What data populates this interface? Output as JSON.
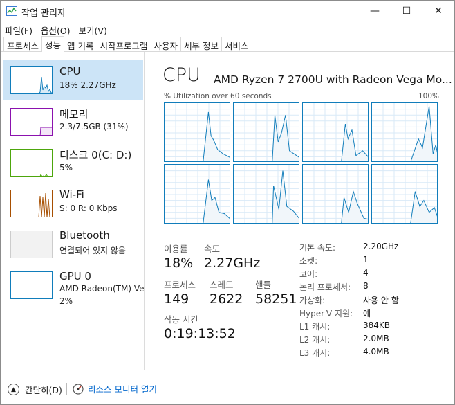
{
  "window": {
    "title": "작업 관리자",
    "controls": {
      "minimize": "—",
      "maximize": "☐",
      "close": "✕"
    }
  },
  "menu": [
    {
      "label": "파일(F)"
    },
    {
      "label": "옵션(O)"
    },
    {
      "label": "보기(V)"
    }
  ],
  "tabs": [
    {
      "label": "프로세스"
    },
    {
      "label": "성능",
      "active": true
    },
    {
      "label": "앱 기록"
    },
    {
      "label": "시작프로그램"
    },
    {
      "label": "사용자"
    },
    {
      "label": "세부 정보"
    },
    {
      "label": "서비스"
    }
  ],
  "sidebar": {
    "items": [
      {
        "name": "CPU",
        "sub": "18% 2.27GHz",
        "color": "#117dbb",
        "selected": true
      },
      {
        "name": "메모리",
        "sub": "2.3/7.5GB (31%)",
        "color": "#8b12ae"
      },
      {
        "name": "디스크 0(C: D:)",
        "sub": "5%",
        "color": "#4da60c"
      },
      {
        "name": "Wi-Fi",
        "sub": "S: 0 R: 0 Kbps",
        "color": "#a74f01"
      },
      {
        "name": "Bluetooth",
        "sub": "연결되어 있지 않음",
        "color": "#bbbbbb"
      },
      {
        "name": "GPU 0",
        "sub": "AMD Radeon(TM) Veg",
        "sub2": "2%",
        "color": "#117dbb"
      }
    ]
  },
  "main": {
    "title": "CPU",
    "model": "AMD Ryzen 7 2700U with Radeon Vega Mo...",
    "util_label": "% Utilization over 60 seconds",
    "util_max": "100%",
    "stats": {
      "utilization_label": "이용률",
      "utilization_value": "18%",
      "speed_label": "속도",
      "speed_value": "2.27GHz",
      "processes_label": "프로세스",
      "processes_value": "149",
      "threads_label": "스레드",
      "threads_value": "2622",
      "handles_label": "핸들",
      "handles_value": "58251",
      "uptime_label": "작동 시간",
      "uptime_value": "0:19:13:52"
    },
    "specs": [
      {
        "label": "기본 속도:",
        "value": "2.20GHz"
      },
      {
        "label": "소켓:",
        "value": "1"
      },
      {
        "label": "코어:",
        "value": "4"
      },
      {
        "label": "논리 프로세서:",
        "value": "8"
      },
      {
        "label": "가상화:",
        "value": "사용 안 함"
      },
      {
        "label": "Hyper-V 지원:",
        "value": "예"
      },
      {
        "label": "L1 캐시:",
        "value": "384KB"
      },
      {
        "label": "L2 캐시:",
        "value": "2.0MB"
      },
      {
        "label": "L3 캐시:",
        "value": "4.0MB"
      }
    ]
  },
  "footer": {
    "fewer_details": "간단히(D)",
    "resource_monitor": "리소스 모니터 열기"
  },
  "colors": {
    "accent": "#117dbb",
    "selected_bg": "#cce4f7",
    "link": "#0066cc"
  }
}
